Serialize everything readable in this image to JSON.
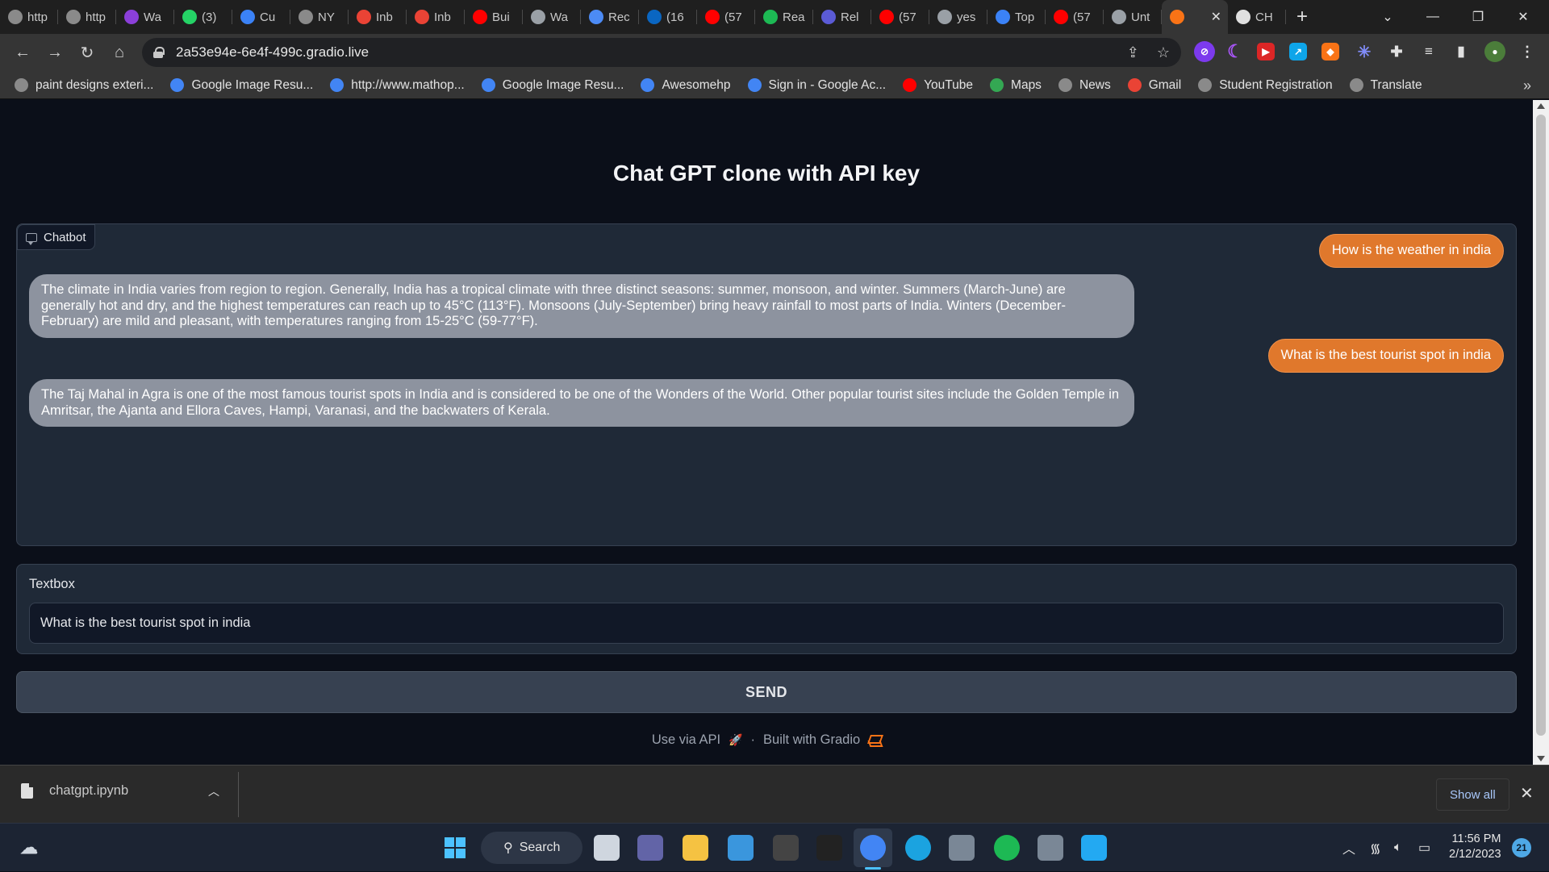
{
  "browser": {
    "tabs": [
      {
        "label": "http",
        "icon": "globe-icon",
        "color": "#8a8a8a"
      },
      {
        "label": "http",
        "icon": "globe-icon",
        "color": "#8a8a8a"
      },
      {
        "label": "Wa",
        "icon": "play-icon",
        "color": "#8b3fd9"
      },
      {
        "label": "(3)",
        "icon": "whatsapp-icon",
        "color": "#25d366"
      },
      {
        "label": "Cu",
        "icon": "bookmark-icon",
        "color": "#3b82f6"
      },
      {
        "label": "NY",
        "icon": "globe-icon",
        "color": "#8a8a8a"
      },
      {
        "label": "Inb",
        "icon": "gmail-icon",
        "color": "#ea4335"
      },
      {
        "label": "Inb",
        "icon": "gmail-icon",
        "color": "#ea4335"
      },
      {
        "label": "Bui",
        "icon": "youtube-icon",
        "color": "#ff0000"
      },
      {
        "label": "Wa",
        "icon": "crossed-icon",
        "color": "#9aa0a6"
      },
      {
        "label": "Rec",
        "icon": "moon-icon",
        "color": "#4c8bf5"
      },
      {
        "label": "(16",
        "icon": "linkedin-icon",
        "color": "#0a66c2"
      },
      {
        "label": "(57",
        "icon": "youtube-icon",
        "color": "#ff0000"
      },
      {
        "label": "Rea",
        "icon": "w-icon",
        "color": "#1db954"
      },
      {
        "label": "Rel",
        "icon": "r-icon",
        "color": "#5b5bd6"
      },
      {
        "label": "(57",
        "icon": "youtube-icon",
        "color": "#ff0000"
      },
      {
        "label": "yes",
        "icon": "play-icon",
        "color": "#9aa0a6"
      },
      {
        "label": "Top",
        "icon": "refresh-icon",
        "color": "#3b82f6"
      },
      {
        "label": "(57",
        "icon": "youtube-icon",
        "color": "#ff0000"
      },
      {
        "label": "Unt",
        "icon": "colab-icon",
        "color": "#9aa0a6"
      },
      {
        "label": "",
        "icon": "gradio-icon",
        "color": "#f97316",
        "active": true
      },
      {
        "label": "CH",
        "icon": "github-icon",
        "color": "#e0e0e0"
      }
    ],
    "url": "2a53e94e-6e4f-499c.gradio.live",
    "bookmarks": [
      {
        "label": "paint designs exteri...",
        "icon": "globe-icon",
        "color": "#8a8a8a"
      },
      {
        "label": "Google Image Resu...",
        "icon": "google-icon",
        "color": "#4285f4"
      },
      {
        "label": "http://www.mathop...",
        "icon": "google-icon",
        "color": "#4285f4"
      },
      {
        "label": "Google Image Resu...",
        "icon": "google-icon",
        "color": "#4285f4"
      },
      {
        "label": "Awesomehp",
        "icon": "google-icon",
        "color": "#4285f4"
      },
      {
        "label": "Sign in - Google Ac...",
        "icon": "google-icon",
        "color": "#4285f4"
      },
      {
        "label": "YouTube",
        "icon": "youtube-icon",
        "color": "#ff0000"
      },
      {
        "label": "Maps",
        "icon": "maps-icon",
        "color": "#34a853"
      },
      {
        "label": "News",
        "icon": "globe-icon",
        "color": "#8a8a8a"
      },
      {
        "label": "Gmail",
        "icon": "gmail-icon",
        "color": "#ea4335"
      },
      {
        "label": "Student Registration",
        "icon": "globe-icon",
        "color": "#8a8a8a"
      },
      {
        "label": "Translate",
        "icon": "globe-icon",
        "color": "#8a8a8a"
      }
    ]
  },
  "app": {
    "title": "Chat GPT clone with API key",
    "chatbot_label": "Chatbot",
    "messages": [
      {
        "role": "user",
        "text": "How is the weather in india"
      },
      {
        "role": "bot",
        "text": "The climate in India varies from region to region. Generally, India has a tropical climate with three distinct seasons: summer, monsoon, and winter. Summers (March-June) are generally hot and dry, and the highest temperatures can reach up to 45°C (113°F). Monsoons (July-September) bring heavy rainfall to most parts of India. Winters (December-February) are mild and pleasant, with temperatures ranging from 15-25°C (59-77°F)."
      },
      {
        "role": "user",
        "text": "What is the best tourist spot in india"
      },
      {
        "role": "bot",
        "text": "The Taj Mahal in Agra is one of the most famous tourist spots in India and is considered to be one of the Wonders of the World. Other popular tourist sites include the Golden Temple in Amritsar, the Ajanta and Ellora Caves, Hampi, Varanasi, and the backwaters of Kerala."
      }
    ],
    "textbox_label": "Textbox",
    "textbox_value": "What is the best tourist spot in india",
    "send_label": "SEND",
    "footer": {
      "api_link": "Use via API",
      "separator": "·",
      "built_with": "Built with Gradio"
    },
    "colors": {
      "user_bubble": "#e0782c",
      "bot_bubble": "#8d939f",
      "background": "#0b0f19",
      "panel": "#1f2937",
      "accent": "#f97316"
    }
  },
  "downloads": {
    "file_name": "chatgpt.ipynb",
    "show_all": "Show all"
  },
  "taskbar": {
    "search_label": "Search",
    "time": "11:56 PM",
    "date": "2/12/2023",
    "notification_count": "21",
    "apps": [
      {
        "icon": "task-view-icon",
        "color": "#cfd6df"
      },
      {
        "icon": "teams-icon",
        "color": "#6264a7"
      },
      {
        "icon": "file-explorer-icon",
        "color": "#f5c242"
      },
      {
        "icon": "store-icon",
        "color": "#3a96dd"
      },
      {
        "icon": "notion-icon",
        "color": "#444444"
      },
      {
        "icon": "dolby-icon",
        "color": "#222222"
      },
      {
        "icon": "chrome-icon",
        "color": "#4285f4"
      },
      {
        "icon": "edge-icon",
        "color": "#1ba3e0"
      },
      {
        "icon": "camera-icon",
        "color": "#7a8796"
      },
      {
        "icon": "spotify-icon",
        "color": "#1db954"
      },
      {
        "icon": "settings-icon",
        "color": "#7a8796"
      },
      {
        "icon": "vscode-icon",
        "color": "#23a9f2"
      }
    ]
  }
}
